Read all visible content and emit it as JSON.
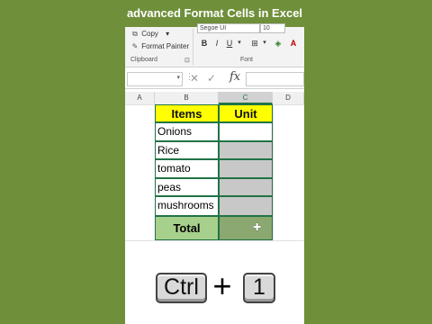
{
  "banner": {
    "title": "advanced Format Cells in Excel"
  },
  "ribbon": {
    "clipboard": {
      "copy_label": "Copy",
      "copy_caret": "▾",
      "format_painter_label": "Format Painter",
      "group_label": "Clipboard",
      "launcher": "⊡"
    },
    "font": {
      "font_name": "Segoe UI",
      "font_size": "10",
      "bold": "B",
      "italic": "I",
      "underline": "U",
      "underline_caret": "▾",
      "border_caret": "▾",
      "group_label": "Font"
    }
  },
  "formula_bar": {
    "name_box_value": "",
    "name_box_caret": "▾",
    "separator": "⋮",
    "cancel": "✕",
    "enter": "✓",
    "fx": "fx",
    "formula_value": ""
  },
  "columns": {
    "a": "A",
    "b": "B",
    "c": "C",
    "d": "D"
  },
  "table": {
    "header_items": "Items",
    "header_unit": "Unit",
    "rows": [
      {
        "item": "Onions"
      },
      {
        "item": "Rice"
      },
      {
        "item": "tomato"
      },
      {
        "item": "peas"
      },
      {
        "item": "mushrooms"
      }
    ],
    "total_label": "Total"
  },
  "shortcut": {
    "key1": "Ctrl",
    "plus": "+",
    "key2": "1"
  },
  "colors": {
    "background": "#6f8f3a",
    "header_fill": "#ffff00",
    "selection": "#217346",
    "total_fill": "#a8d08d",
    "grey_fill": "#c8c8c8"
  }
}
